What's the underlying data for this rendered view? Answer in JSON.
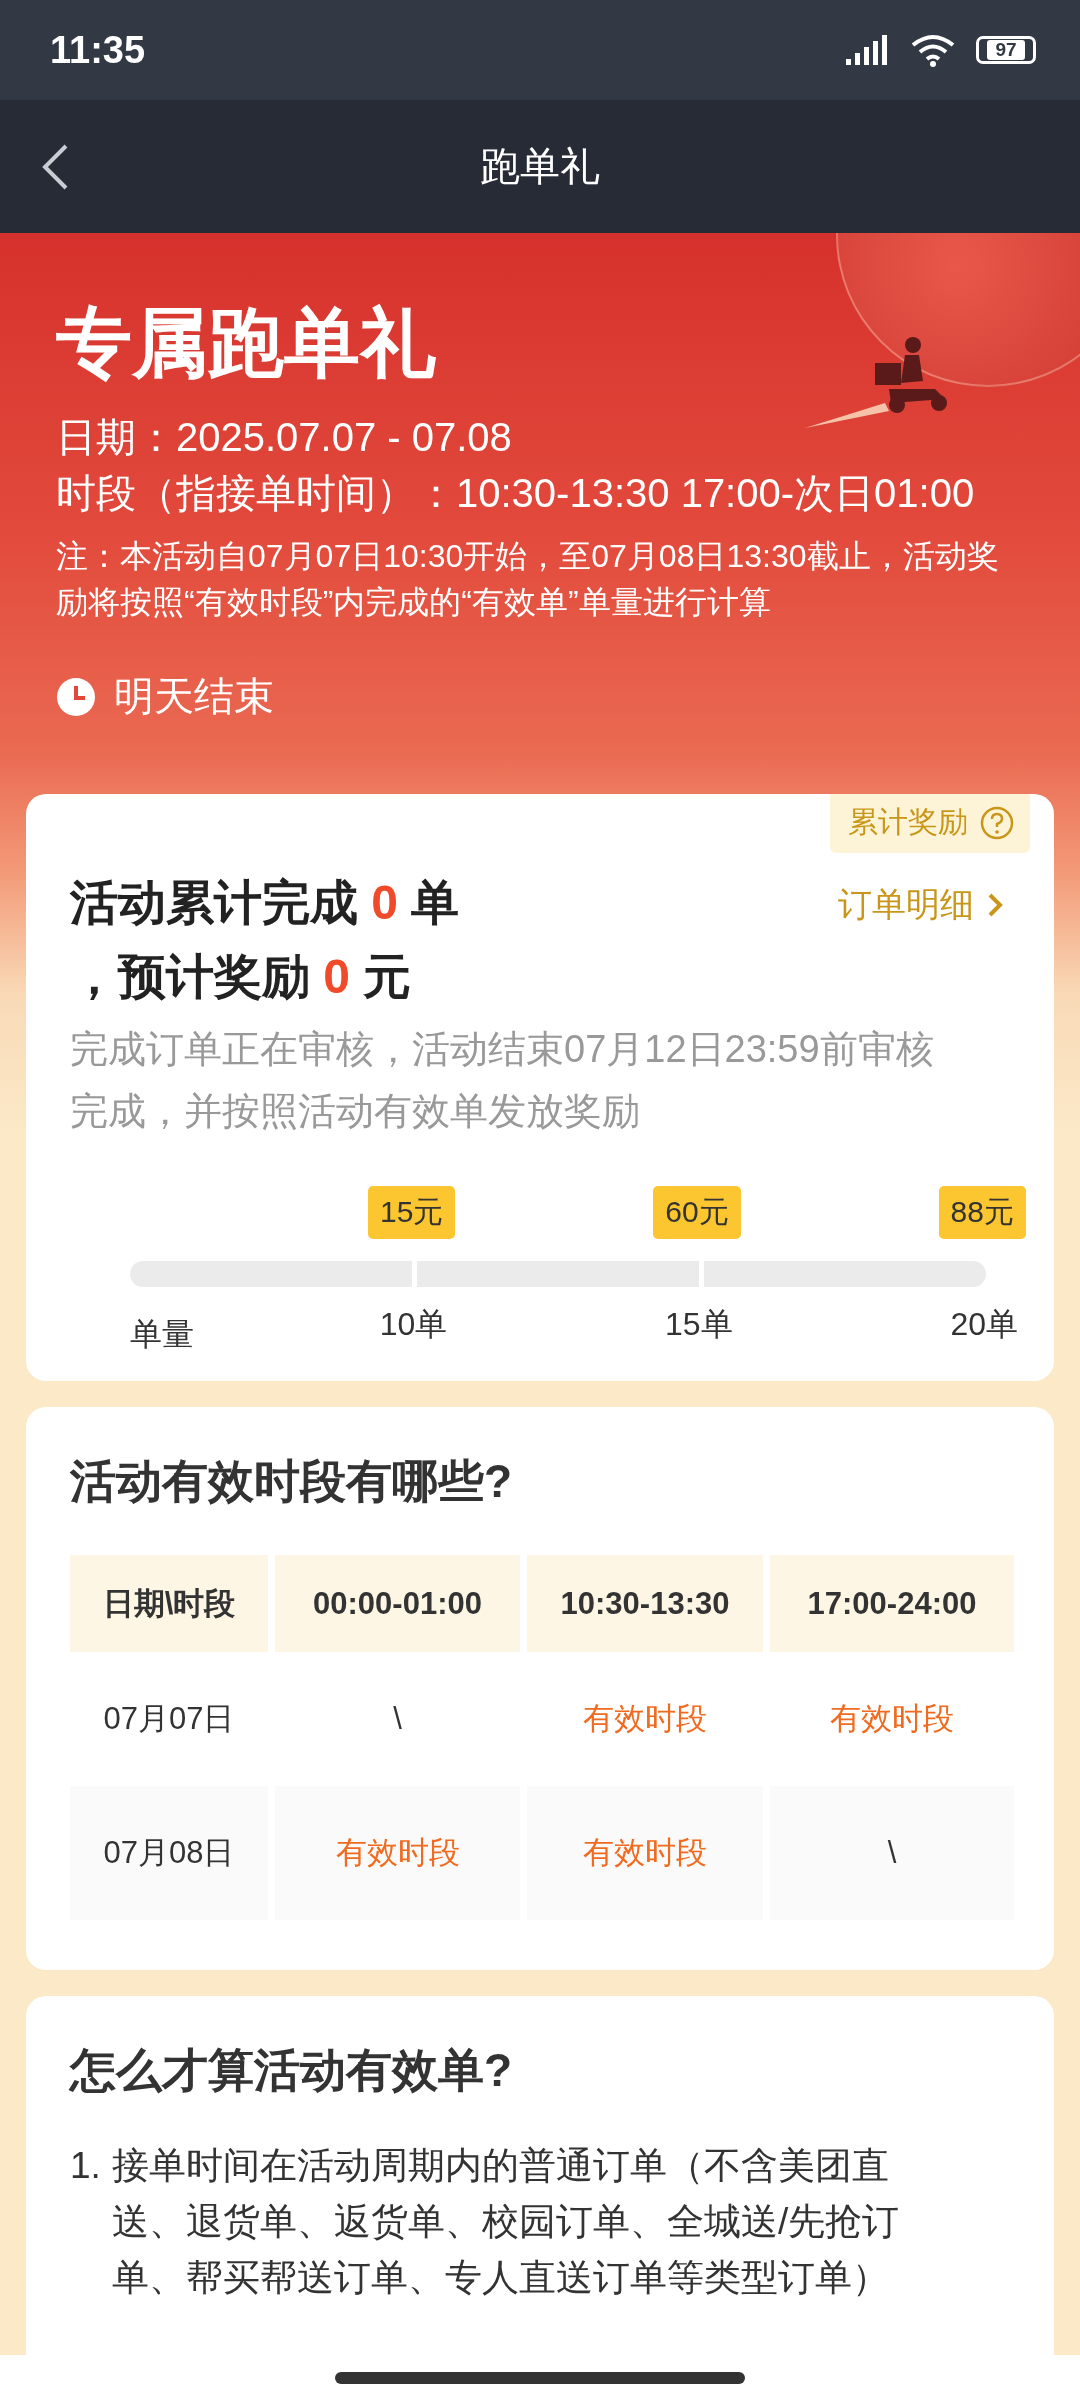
{
  "status_bar": {
    "time": "11:35",
    "battery": "97"
  },
  "nav": {
    "title": "跑单礼"
  },
  "banner": {
    "title": "专属跑单礼",
    "date_line": "日期：2025.07.07 - 07.08",
    "period_line": "时段（指接单时间）：10:30-13:30 17:00-次日01:00",
    "note": "注：本活动自07月07日10:30开始，至07月08日13:30截止，活动奖励将按照“有效时段”内完成的“有效单”单量进行计算",
    "countdown": "明天结束"
  },
  "summary": {
    "tag": "累计奖励",
    "detail_link": "订单明细",
    "completed_prefix": "活动累计完成",
    "completed_count": "0",
    "completed_unit": "单",
    "reward_prefix": "，预计奖励",
    "reward_amount": "0",
    "reward_unit": "元",
    "review_note": "完成订单正在审核，活动结束07月12日23:59前审核完成，并按照活动有效单发放奖励"
  },
  "progress": {
    "axis_label": "单量",
    "milestones": [
      {
        "label": "10单",
        "reward": "15元"
      },
      {
        "label": "15单",
        "reward": "60元"
      },
      {
        "label": "20单",
        "reward": "88元"
      }
    ]
  },
  "schedule": {
    "title": "活动有效时段有哪些?",
    "columns": [
      "日期\\时段",
      "00:00-01:00",
      "10:30-13:30",
      "17:00-24:00"
    ],
    "rows": [
      {
        "cells": [
          {
            "kind": "date",
            "text": "07月07日"
          },
          {
            "kind": "empty",
            "text": "\\"
          },
          {
            "kind": "valid",
            "text": "有效时段"
          },
          {
            "kind": "valid",
            "text": "有效时段"
          }
        ]
      },
      {
        "cells": [
          {
            "kind": "date",
            "text": "07月08日"
          },
          {
            "kind": "valid",
            "text": "有效时段"
          },
          {
            "kind": "valid",
            "text": "有效时段"
          },
          {
            "kind": "empty",
            "text": "\\"
          }
        ]
      }
    ]
  },
  "rules": {
    "title": "怎么才算活动有效单?",
    "items": [
      {
        "number": "1.",
        "text": "接单时间在活动周期内的普通订单（不含美团直送、退货单、返货单、校园订单、全城送/先抢订单、帮买帮送订单、专人直送订单等类型订单）"
      }
    ]
  }
}
